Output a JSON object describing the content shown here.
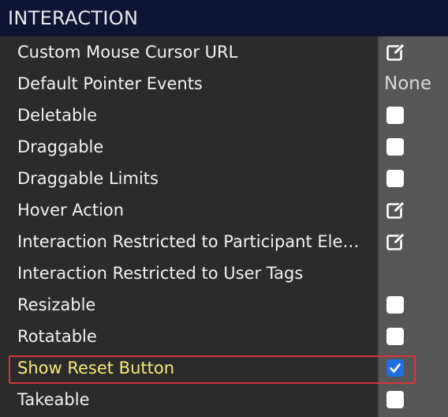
{
  "section": {
    "title": "INTERACTION"
  },
  "rows": [
    {
      "label": "Custom Mouse Cursor URL",
      "control": "edit-icon"
    },
    {
      "label": "Default Pointer Events",
      "control": "text",
      "value": "None"
    },
    {
      "label": "Deletable",
      "control": "checkbox",
      "checked": false
    },
    {
      "label": "Draggable",
      "control": "checkbox",
      "checked": false
    },
    {
      "label": "Draggable Limits",
      "control": "checkbox",
      "checked": false
    },
    {
      "label": "Hover Action",
      "control": "edit-icon"
    },
    {
      "label": "Interaction Restricted to Participant Ele…",
      "control": "edit-icon"
    },
    {
      "label": "Interaction Restricted to User Tags",
      "control": "none"
    },
    {
      "label": "Resizable",
      "control": "checkbox",
      "checked": false
    },
    {
      "label": "Rotatable",
      "control": "checkbox",
      "checked": false
    },
    {
      "label": "Show Reset Button",
      "control": "checkbox",
      "checked": true,
      "highlighted": true
    },
    {
      "label": "Takeable",
      "control": "checkbox",
      "checked": false
    }
  ],
  "colors": {
    "header_bg": "#0f1433",
    "highlight_text": "#f3ea7a",
    "highlight_border": "#d4353f",
    "checkbox_checked": "#1f6fe0"
  }
}
